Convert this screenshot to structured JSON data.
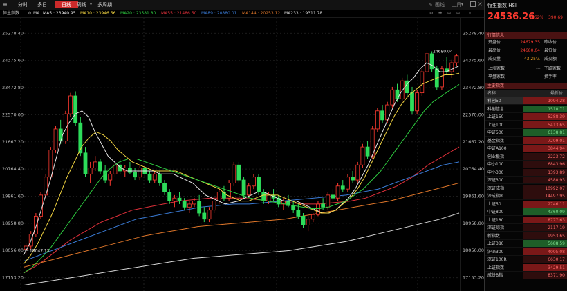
{
  "toolbar": {
    "tabs": [
      "分时",
      "多日",
      "日线",
      "周线",
      "多周期"
    ],
    "active_tab": "日线",
    "tools": [
      "画线",
      "工具"
    ]
  },
  "ma_bar": {
    "index_label": "恒生指数",
    "ma_label": "MA",
    "items": [
      {
        "text": "MA5 : 23940.95",
        "color": "#e8e8e8"
      },
      {
        "text": "MA10 : 23946.56",
        "color": "#f5d742"
      },
      {
        "text": "MA20 : 23581.80",
        "color": "#2ecc40"
      },
      {
        "text": "MA55 : 21486.50",
        "color": "#e0303a"
      },
      {
        "text": "MA89 : 20880.01",
        "color": "#3a7bd5"
      },
      {
        "text": "MA144 : 20253.12",
        "color": "#e0772a"
      },
      {
        "text": "MA233 : 19311.78",
        "color": "#d8d8d8"
      }
    ]
  },
  "chart_data": {
    "type": "candlestick",
    "ylim": [
      16800,
      25700
    ],
    "y_ticks": [
      "25278.40",
      "24375.60",
      "23472.80",
      "22570.00",
      "21667.20",
      "20764.40",
      "19861.60",
      "18958.80",
      "18056.00",
      "17153.20"
    ],
    "annotations": [
      {
        "text": "24680.04",
        "value": 24680.04
      },
      {
        "text": "← 18047.13",
        "value": 18047.13
      }
    ],
    "candles": [
      {
        "o": 18100,
        "h": 18300,
        "l": 17900,
        "c": 18200
      },
      {
        "o": 18200,
        "h": 18700,
        "l": 18100,
        "c": 18600
      },
      {
        "o": 18600,
        "h": 19300,
        "l": 18500,
        "c": 19200
      },
      {
        "o": 19200,
        "h": 20000,
        "l": 19100,
        "c": 19900
      },
      {
        "o": 19900,
        "h": 20600,
        "l": 19800,
        "c": 20500
      },
      {
        "o": 20500,
        "h": 21500,
        "l": 20400,
        "c": 21400
      },
      {
        "o": 21400,
        "h": 22200,
        "l": 21300,
        "c": 22100
      },
      {
        "o": 22100,
        "h": 22400,
        "l": 21600,
        "c": 21700
      },
      {
        "o": 21700,
        "h": 22700,
        "l": 21600,
        "c": 22600
      },
      {
        "o": 22600,
        "h": 23300,
        "l": 22500,
        "c": 23200
      },
      {
        "o": 23200,
        "h": 23350,
        "l": 22200,
        "c": 22300
      },
      {
        "o": 22300,
        "h": 22500,
        "l": 21200,
        "c": 21300
      },
      {
        "o": 21300,
        "h": 21500,
        "l": 20500,
        "c": 20600
      },
      {
        "o": 20600,
        "h": 21000,
        "l": 20300,
        "c": 20800
      },
      {
        "o": 20800,
        "h": 21200,
        "l": 20700,
        "c": 21000
      },
      {
        "o": 21000,
        "h": 21100,
        "l": 20600,
        "c": 20700
      },
      {
        "o": 20700,
        "h": 20900,
        "l": 20300,
        "c": 20400
      },
      {
        "o": 20400,
        "h": 20700,
        "l": 20200,
        "c": 20600
      },
      {
        "o": 20600,
        "h": 21000,
        "l": 20500,
        "c": 20900
      },
      {
        "o": 20900,
        "h": 21100,
        "l": 20600,
        "c": 20700
      },
      {
        "o": 20700,
        "h": 20900,
        "l": 20500,
        "c": 20800
      },
      {
        "o": 20800,
        "h": 21000,
        "l": 20600,
        "c": 20650
      },
      {
        "o": 20650,
        "h": 20800,
        "l": 20400,
        "c": 20500
      },
      {
        "o": 20500,
        "h": 20900,
        "l": 20400,
        "c": 20800
      },
      {
        "o": 20800,
        "h": 20900,
        "l": 20500,
        "c": 20600
      },
      {
        "o": 20600,
        "h": 20700,
        "l": 20300,
        "c": 20400
      },
      {
        "o": 20400,
        "h": 20700,
        "l": 20300,
        "c": 20600
      },
      {
        "o": 20600,
        "h": 20700,
        "l": 20200,
        "c": 20300
      },
      {
        "o": 20300,
        "h": 20400,
        "l": 19900,
        "c": 20000
      },
      {
        "o": 20000,
        "h": 20100,
        "l": 19600,
        "c": 19700
      },
      {
        "o": 19700,
        "h": 19900,
        "l": 19500,
        "c": 19800
      },
      {
        "o": 19800,
        "h": 20000,
        "l": 19600,
        "c": 19700
      },
      {
        "o": 19700,
        "h": 19800,
        "l": 19400,
        "c": 19500
      },
      {
        "o": 19500,
        "h": 19700,
        "l": 19300,
        "c": 19600
      },
      {
        "o": 19600,
        "h": 19800,
        "l": 19500,
        "c": 19700
      },
      {
        "o": 19700,
        "h": 19900,
        "l": 19200,
        "c": 19300
      },
      {
        "o": 19300,
        "h": 19500,
        "l": 19000,
        "c": 19100
      },
      {
        "o": 19100,
        "h": 19500,
        "l": 19000,
        "c": 19400
      },
      {
        "o": 19400,
        "h": 19800,
        "l": 19300,
        "c": 19700
      },
      {
        "o": 19700,
        "h": 20100,
        "l": 19600,
        "c": 20000
      },
      {
        "o": 20000,
        "h": 20200,
        "l": 19700,
        "c": 19800
      },
      {
        "o": 19800,
        "h": 20400,
        "l": 19700,
        "c": 20300
      },
      {
        "o": 20300,
        "h": 21000,
        "l": 20200,
        "c": 20900
      },
      {
        "o": 20900,
        "h": 21000,
        "l": 20300,
        "c": 20400
      },
      {
        "o": 20400,
        "h": 20500,
        "l": 19800,
        "c": 19900
      },
      {
        "o": 19900,
        "h": 20300,
        "l": 19800,
        "c": 20200
      },
      {
        "o": 20200,
        "h": 20600,
        "l": 20100,
        "c": 20500
      },
      {
        "o": 20500,
        "h": 20600,
        "l": 19900,
        "c": 20000
      },
      {
        "o": 20000,
        "h": 20100,
        "l": 19600,
        "c": 19700
      },
      {
        "o": 19700,
        "h": 20000,
        "l": 19600,
        "c": 19900
      },
      {
        "o": 19900,
        "h": 20100,
        "l": 19700,
        "c": 19800
      },
      {
        "o": 19800,
        "h": 19900,
        "l": 19500,
        "c": 19600
      },
      {
        "o": 19600,
        "h": 19800,
        "l": 19400,
        "c": 19700
      },
      {
        "o": 19700,
        "h": 19900,
        "l": 19500,
        "c": 19550
      },
      {
        "o": 19550,
        "h": 19700,
        "l": 19300,
        "c": 19400
      },
      {
        "o": 19400,
        "h": 19600,
        "l": 19100,
        "c": 19200
      },
      {
        "o": 19200,
        "h": 19300,
        "l": 18800,
        "c": 18900
      },
      {
        "o": 18900,
        "h": 19200,
        "l": 18700,
        "c": 19100
      },
      {
        "o": 19100,
        "h": 19300,
        "l": 19000,
        "c": 19250
      },
      {
        "o": 19250,
        "h": 19700,
        "l": 19200,
        "c": 19600
      },
      {
        "o": 19600,
        "h": 19800,
        "l": 19400,
        "c": 19500
      },
      {
        "o": 19500,
        "h": 20000,
        "l": 19400,
        "c": 19900
      },
      {
        "o": 19900,
        "h": 20100,
        "l": 19700,
        "c": 19800
      },
      {
        "o": 19800,
        "h": 20300,
        "l": 19700,
        "c": 20200
      },
      {
        "o": 20200,
        "h": 20400,
        "l": 20000,
        "c": 20100
      },
      {
        "o": 20100,
        "h": 20600,
        "l": 20000,
        "c": 20500
      },
      {
        "o": 20500,
        "h": 20700,
        "l": 20300,
        "c": 20400
      },
      {
        "o": 20400,
        "h": 21000,
        "l": 20300,
        "c": 20900
      },
      {
        "o": 20900,
        "h": 21600,
        "l": 20800,
        "c": 21500
      },
      {
        "o": 21500,
        "h": 21700,
        "l": 21100,
        "c": 21200
      },
      {
        "o": 21200,
        "h": 22200,
        "l": 21100,
        "c": 22100
      },
      {
        "o": 22100,
        "h": 22800,
        "l": 22000,
        "c": 22700
      },
      {
        "o": 22700,
        "h": 22900,
        "l": 22300,
        "c": 22400
      },
      {
        "o": 22400,
        "h": 23000,
        "l": 22300,
        "c": 22900
      },
      {
        "o": 22900,
        "h": 23500,
        "l": 22800,
        "c": 23400
      },
      {
        "o": 23400,
        "h": 23600,
        "l": 23000,
        "c": 23100
      },
      {
        "o": 23100,
        "h": 23800,
        "l": 23000,
        "c": 23700
      },
      {
        "o": 23700,
        "h": 23900,
        "l": 23200,
        "c": 23300
      },
      {
        "o": 23300,
        "h": 23500,
        "l": 22600,
        "c": 22700
      },
      {
        "o": 22700,
        "h": 23400,
        "l": 22600,
        "c": 23300
      },
      {
        "o": 23300,
        "h": 24100,
        "l": 23200,
        "c": 24000
      },
      {
        "o": 24000,
        "h": 24680,
        "l": 23900,
        "c": 24600
      },
      {
        "o": 24600,
        "h": 24680,
        "l": 24000,
        "c": 24100
      },
      {
        "o": 24100,
        "h": 24200,
        "l": 23400,
        "c": 23500
      },
      {
        "o": 23500,
        "h": 24200,
        "l": 23400,
        "c": 24100
      },
      {
        "o": 24100,
        "h": 24500,
        "l": 23900,
        "c": 24000
      },
      {
        "o": 24000,
        "h": 24400,
        "l": 23800,
        "c": 24300
      },
      {
        "o": 24300,
        "h": 24600,
        "l": 24200,
        "c": 24536
      }
    ],
    "ma_lines": [
      {
        "name": "MA5",
        "color": "#e8e8e8",
        "points": [
          17900,
          18300,
          18900,
          19600,
          20300,
          21100,
          21900,
          22300,
          22600,
          22700,
          22500,
          22000,
          21600,
          21200,
          21000,
          20800,
          20700,
          20700,
          20700,
          20700,
          20700,
          20600,
          20600,
          20600,
          20500,
          20400,
          20300,
          20100,
          19900,
          19800,
          19700,
          19600,
          19650,
          19700,
          19800,
          19900,
          20000,
          20000,
          19900,
          19800,
          19700,
          19700,
          19700,
          19600,
          19500,
          19400,
          19300,
          19300,
          19400,
          19600,
          19800,
          20100,
          20500,
          20900,
          21400,
          21900,
          22400,
          22900,
          23300,
          23600,
          23800,
          24100,
          24300,
          24200,
          24000,
          24000,
          24100,
          24200
        ]
      },
      {
        "name": "MA10",
        "color": "#f5d742",
        "points": [
          17600,
          17900,
          18300,
          18800,
          19300,
          19900,
          20500,
          21000,
          21500,
          21800,
          22000,
          21900,
          21700,
          21400,
          21200,
          21000,
          20900,
          20800,
          20700,
          20700,
          20700,
          20700,
          20600,
          20500,
          20400,
          20300,
          20200,
          20100,
          19900,
          19800,
          19700,
          19700,
          19800,
          19900,
          19900,
          19900,
          19800,
          19700,
          19600,
          19500,
          19400,
          19300,
          19300,
          19400,
          19600,
          19800,
          20100,
          20500,
          21000,
          21500,
          22000,
          22500,
          22900,
          23200,
          23400,
          23600,
          23700,
          23800,
          23900,
          23900,
          23950
        ]
      },
      {
        "name": "MA20",
        "color": "#2ecc40",
        "points": [
          17300,
          17500,
          17800,
          18100,
          18500,
          18900,
          19300,
          19700,
          20100,
          20500,
          20800,
          21000,
          21100,
          21100,
          21000,
          20900,
          20800,
          20700,
          20600,
          20500,
          20400,
          20300,
          20200,
          20100,
          20000,
          19900,
          19800,
          19750,
          19700,
          19650,
          19600,
          19550,
          19500,
          19450,
          19450,
          19500,
          19600,
          19700,
          19900,
          20100,
          20400,
          20700,
          21100,
          21500,
          21900,
          22300,
          22700,
          23000,
          23200,
          23400,
          23580
        ]
      }
    ],
    "trend_lines": [
      {
        "name": "MA55",
        "color": "#e0303a",
        "points": [
          17300,
          17600,
          18000,
          18400,
          18700,
          19000,
          19200,
          19400,
          19500,
          19600,
          19700,
          19750,
          19800,
          19800,
          19800,
          19750,
          19700,
          19650,
          19600,
          19600,
          19650,
          19700,
          19800,
          20000,
          20200,
          20500,
          20900,
          21200,
          21500
        ]
      },
      {
        "name": "MA89",
        "color": "#3a7bd5",
        "points": [
          17700,
          17900,
          18100,
          18300,
          18500,
          18700,
          18900,
          19100,
          19200,
          19300,
          19400,
          19500,
          19550,
          19600,
          19600,
          19650,
          19700,
          19750,
          19800,
          19850,
          19900,
          20000,
          20100,
          20300,
          20500,
          20700,
          20900,
          21000
        ]
      },
      {
        "name": "MA144",
        "color": "#e0772a",
        "points": [
          17500,
          17650,
          17800,
          17950,
          18100,
          18250,
          18400,
          18550,
          18650,
          18750,
          18850,
          18900,
          18950,
          19000,
          19050,
          19100,
          19200,
          19300,
          19400,
          19500,
          19600,
          19700,
          19850,
          20000,
          20150,
          20300
        ]
      },
      {
        "name": "MA233",
        "color": "#d8d8d8",
        "points": [
          16900,
          17000,
          17100,
          17200,
          17300,
          17400,
          17500,
          17600,
          17700,
          17800,
          17850,
          17900,
          17950,
          18000,
          18050,
          18150,
          18250,
          18350,
          18500,
          18650,
          18800,
          18950,
          19100,
          19300
        ]
      }
    ]
  },
  "side": {
    "index_name": "恒生指数 HSI",
    "price": "24536.26",
    "pct": "1.62%",
    "change": "390.69",
    "quote_header": "行情信息",
    "quote_rows": [
      {
        "label": "开盘价",
        "value": "24679.35",
        "label2": "昨收价",
        "v2": ""
      },
      {
        "label": "最高价",
        "value": "24680.04",
        "label2": "最低价",
        "v2": ""
      },
      {
        "label": "成交量",
        "value": "43.25亿",
        "label2": "成交额",
        "v2": ""
      },
      {
        "label": "上涨家数",
        "value": "",
        "label2": "下跌家数",
        "v2": "---"
      },
      {
        "label": "平盘家数",
        "value": "",
        "label2": "换手率",
        "v2": "---"
      }
    ],
    "list_header": "主要指数",
    "col_name": "名称",
    "col_price": "最新价",
    "list": [
      {
        "n": "科创50",
        "p": "1094.28",
        "c": "#7a1818",
        "sel": true
      },
      {
        "n": "科创信息",
        "p": "1510.71",
        "c": "#1e5e28"
      },
      {
        "n": "上证150",
        "p": "5288.39",
        "c": "#7a1818"
      },
      {
        "n": "上证100",
        "p": "5413.65",
        "c": "#7a1818"
      },
      {
        "n": "中证500",
        "p": "6138.81",
        "c": "#1e5e28"
      },
      {
        "n": "基金指数",
        "p": "7209.01",
        "c": "#7a1818"
      },
      {
        "n": "中证A100",
        "p": "3844.94",
        "c": "#7a1818"
      },
      {
        "n": "创业板指",
        "p": "2223.72",
        "c": "#2e0d0d"
      },
      {
        "n": "中小100",
        "p": "6843.96",
        "c": "#2e0d0d"
      },
      {
        "n": "中小300",
        "p": "1393.89",
        "c": "#2e0d0d"
      },
      {
        "n": "深证300",
        "p": "4580.93",
        "c": "#2e0d0d"
      },
      {
        "n": "深证成指",
        "p": "10992.07",
        "c": "#2e0d0d"
      },
      {
        "n": "深成指R",
        "p": "14497.95",
        "c": "#2e0d0d"
      },
      {
        "n": "上证50",
        "p": "2746.11",
        "c": "#7a1818"
      },
      {
        "n": "中证800",
        "p": "4360.09",
        "c": "#1e5e28"
      },
      {
        "n": "上证180",
        "p": "8777.63",
        "c": "#7a1818"
      },
      {
        "n": "深证综指",
        "p": "2117.19",
        "c": "#2e0d0d"
      },
      {
        "n": "新指数",
        "p": "9953.65",
        "c": "#2e0d0d"
      },
      {
        "n": "上证380",
        "p": "5688.59",
        "c": "#1e5e28"
      },
      {
        "n": "沪深300",
        "p": "4005.08",
        "c": "#7a1818"
      },
      {
        "n": "深证100R",
        "p": "6630.17",
        "c": "#2e0d0d"
      },
      {
        "n": "上证指数",
        "p": "3429.51",
        "c": "#7a1818"
      },
      {
        "n": "成份B指",
        "p": "8371.90",
        "c": "#2e0d0d"
      }
    ]
  }
}
